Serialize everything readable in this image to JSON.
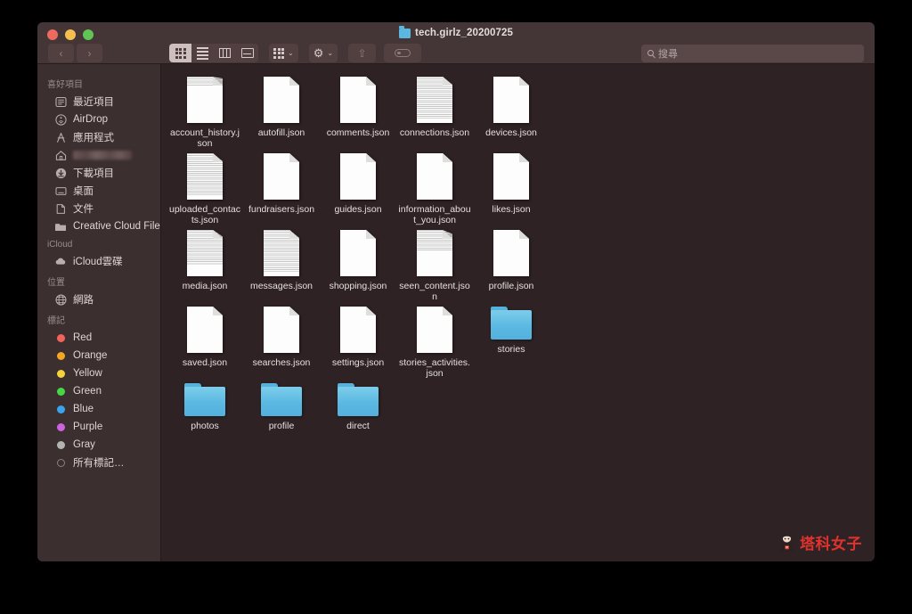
{
  "window": {
    "title": "tech.girlz_20200725",
    "title_icon": "folder-icon",
    "traffic_lights": [
      {
        "name": "close",
        "color": "#ed6a5f"
      },
      {
        "name": "minimize",
        "color": "#f5bf4f"
      },
      {
        "name": "zoom",
        "color": "#61c454"
      }
    ]
  },
  "toolbar": {
    "back_glyph": "‹",
    "forward_glyph": "›",
    "view_modes": [
      {
        "name": "icon-view",
        "active": true
      },
      {
        "name": "list-view",
        "active": false
      },
      {
        "name": "column-view",
        "active": false
      },
      {
        "name": "gallery-view",
        "active": false
      }
    ],
    "group_label": "",
    "caret_glyph": "⌄",
    "gear_glyph": "⚙",
    "share_glyph": "⇧",
    "tag_label": ""
  },
  "search": {
    "placeholder": "搜尋",
    "value": "",
    "icon": "search-icon"
  },
  "sidebar": {
    "sections": [
      {
        "header": "喜好項目",
        "items": [
          {
            "label": "最近項目",
            "icon": "recents-icon"
          },
          {
            "label": "AirDrop",
            "icon": "airdrop-icon"
          },
          {
            "label": "應用程式",
            "icon": "applications-icon"
          },
          {
            "label": "",
            "icon": "home-icon",
            "redacted": true
          },
          {
            "label": "下載項目",
            "icon": "downloads-icon"
          },
          {
            "label": "桌面",
            "icon": "desktop-icon"
          },
          {
            "label": "文件",
            "icon": "documents-icon"
          },
          {
            "label": "Creative Cloud Files",
            "icon": "folder-icon"
          }
        ]
      },
      {
        "header": "iCloud",
        "items": [
          {
            "label": "iCloud雲碟",
            "icon": "cloud-icon"
          }
        ]
      },
      {
        "header": "位置",
        "items": [
          {
            "label": "網路",
            "icon": "network-icon"
          }
        ]
      },
      {
        "header": "標記",
        "items": [
          {
            "label": "Red",
            "icon": "tag-dot-icon",
            "color": "#f0645c"
          },
          {
            "label": "Orange",
            "icon": "tag-dot-icon",
            "color": "#f5a623"
          },
          {
            "label": "Yellow",
            "icon": "tag-dot-icon",
            "color": "#f3d23c"
          },
          {
            "label": "Green",
            "icon": "tag-dot-icon",
            "color": "#46d844"
          },
          {
            "label": "Blue",
            "icon": "tag-dot-icon",
            "color": "#3aa3f0"
          },
          {
            "label": "Purple",
            "icon": "tag-dot-icon",
            "color": "#cc63e0"
          },
          {
            "label": "Gray",
            "icon": "tag-dot-icon",
            "color": "#b4b4b4"
          },
          {
            "label": "所有標記…",
            "icon": "all-tags-icon",
            "color": null
          }
        ]
      }
    ]
  },
  "files": [
    {
      "name": "account_history.json",
      "type": "file",
      "preview": "p20"
    },
    {
      "name": "autofill.json",
      "type": "file",
      "preview": "p0"
    },
    {
      "name": "comments.json",
      "type": "file",
      "preview": "p0"
    },
    {
      "name": "connections.json",
      "type": "file",
      "preview": "p90"
    },
    {
      "name": "devices.json",
      "type": "file",
      "preview": "p0"
    },
    {
      "name": "uploaded_contacts.json",
      "type": "file",
      "preview": "p90"
    },
    {
      "name": "fundraisers.json",
      "type": "file",
      "preview": "p0"
    },
    {
      "name": "guides.json",
      "type": "file",
      "preview": "p0"
    },
    {
      "name": "information_about_you.json",
      "type": "file",
      "preview": "p0"
    },
    {
      "name": "likes.json",
      "type": "file",
      "preview": "p0"
    },
    {
      "name": "media.json",
      "type": "file",
      "preview": "p75"
    },
    {
      "name": "messages.json",
      "type": "file",
      "preview": "p90"
    },
    {
      "name": "shopping.json",
      "type": "file",
      "preview": "p0"
    },
    {
      "name": "seen_content.json",
      "type": "file",
      "preview": "p45"
    },
    {
      "name": "profile.json",
      "type": "file",
      "preview": "p0"
    },
    {
      "name": "saved.json",
      "type": "file",
      "preview": "p0"
    },
    {
      "name": "searches.json",
      "type": "file",
      "preview": "p0"
    },
    {
      "name": "settings.json",
      "type": "file",
      "preview": "p0"
    },
    {
      "name": "stories_activities.json",
      "type": "file",
      "preview": "p0"
    }
  ],
  "folders": [
    {
      "name": "stories",
      "type": "folder"
    },
    {
      "name": "photos",
      "type": "folder"
    },
    {
      "name": "profile",
      "type": "folder"
    },
    {
      "name": "direct",
      "type": "folder"
    }
  ],
  "watermark": {
    "text": "塔科女子",
    "color": "#e0322e",
    "icon": "mascot-icon"
  }
}
